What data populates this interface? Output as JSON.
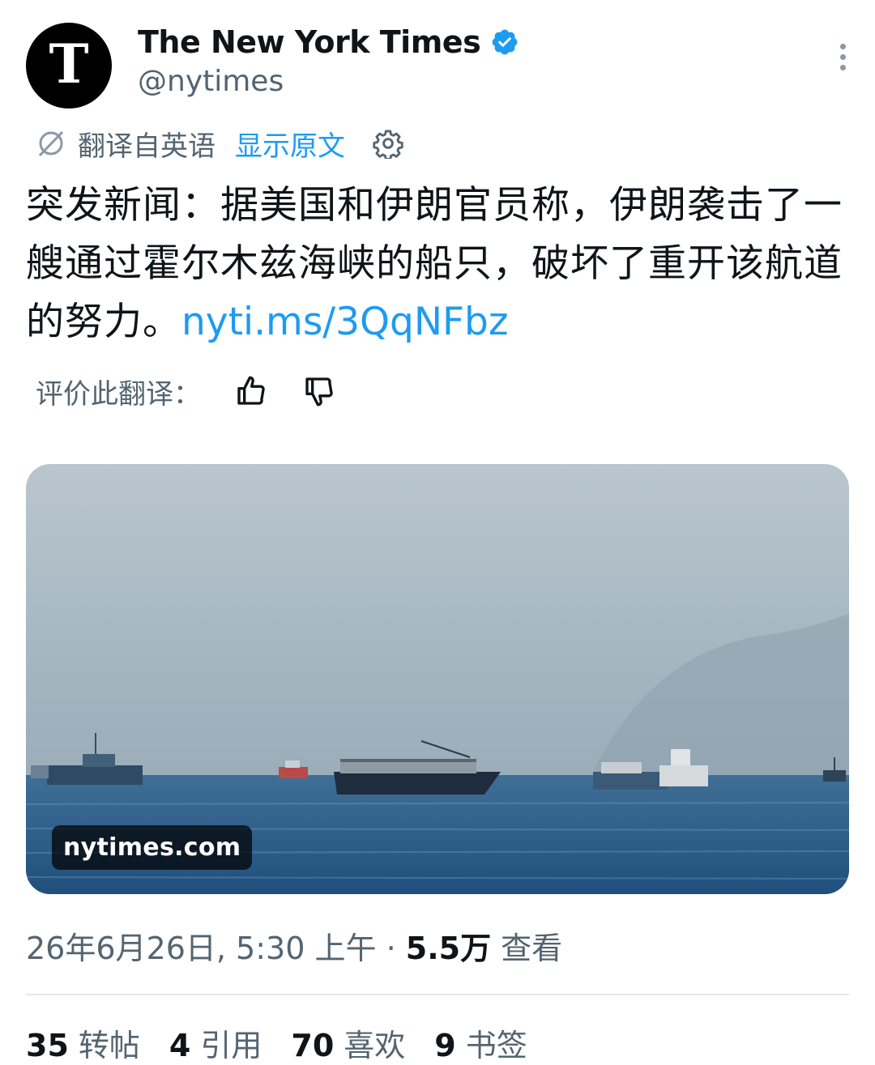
{
  "account": {
    "avatar_glyph": "T",
    "display_name": "The New York Times",
    "handle": "@nytimes",
    "verified_color": "#1d9bf0"
  },
  "translation": {
    "label": "翻译自英语",
    "show_original": "显示原文",
    "icons": [
      "translate-icon",
      "gear-icon"
    ]
  },
  "tweet": {
    "text": "突发新闻：据美国和伊朗官员称，伊朗袭击了一艘通过霍尔木兹海峡的船只，破坏了重开该航道的努力。",
    "link": "nyti.ms/3QqNFbz"
  },
  "rating": {
    "label": "评价此翻译：",
    "icons": [
      "thumbs-up-icon",
      "thumbs-down-icon"
    ]
  },
  "media": {
    "source": "nytimes.com"
  },
  "meta": {
    "timestamp": "26年6月26日, 5:30 上午",
    "separator": "·",
    "views_count": "5.5万",
    "views_label": "查看"
  },
  "stats": [
    {
      "count": "35",
      "label": "转帖"
    },
    {
      "count": "4",
      "label": "引用"
    },
    {
      "count": "70",
      "label": "喜欢"
    },
    {
      "count": "9",
      "label": "书签"
    }
  ],
  "colors": {
    "accent": "#1d9bf0",
    "secondary_text": "#536471",
    "primary_text": "#0f1419"
  }
}
